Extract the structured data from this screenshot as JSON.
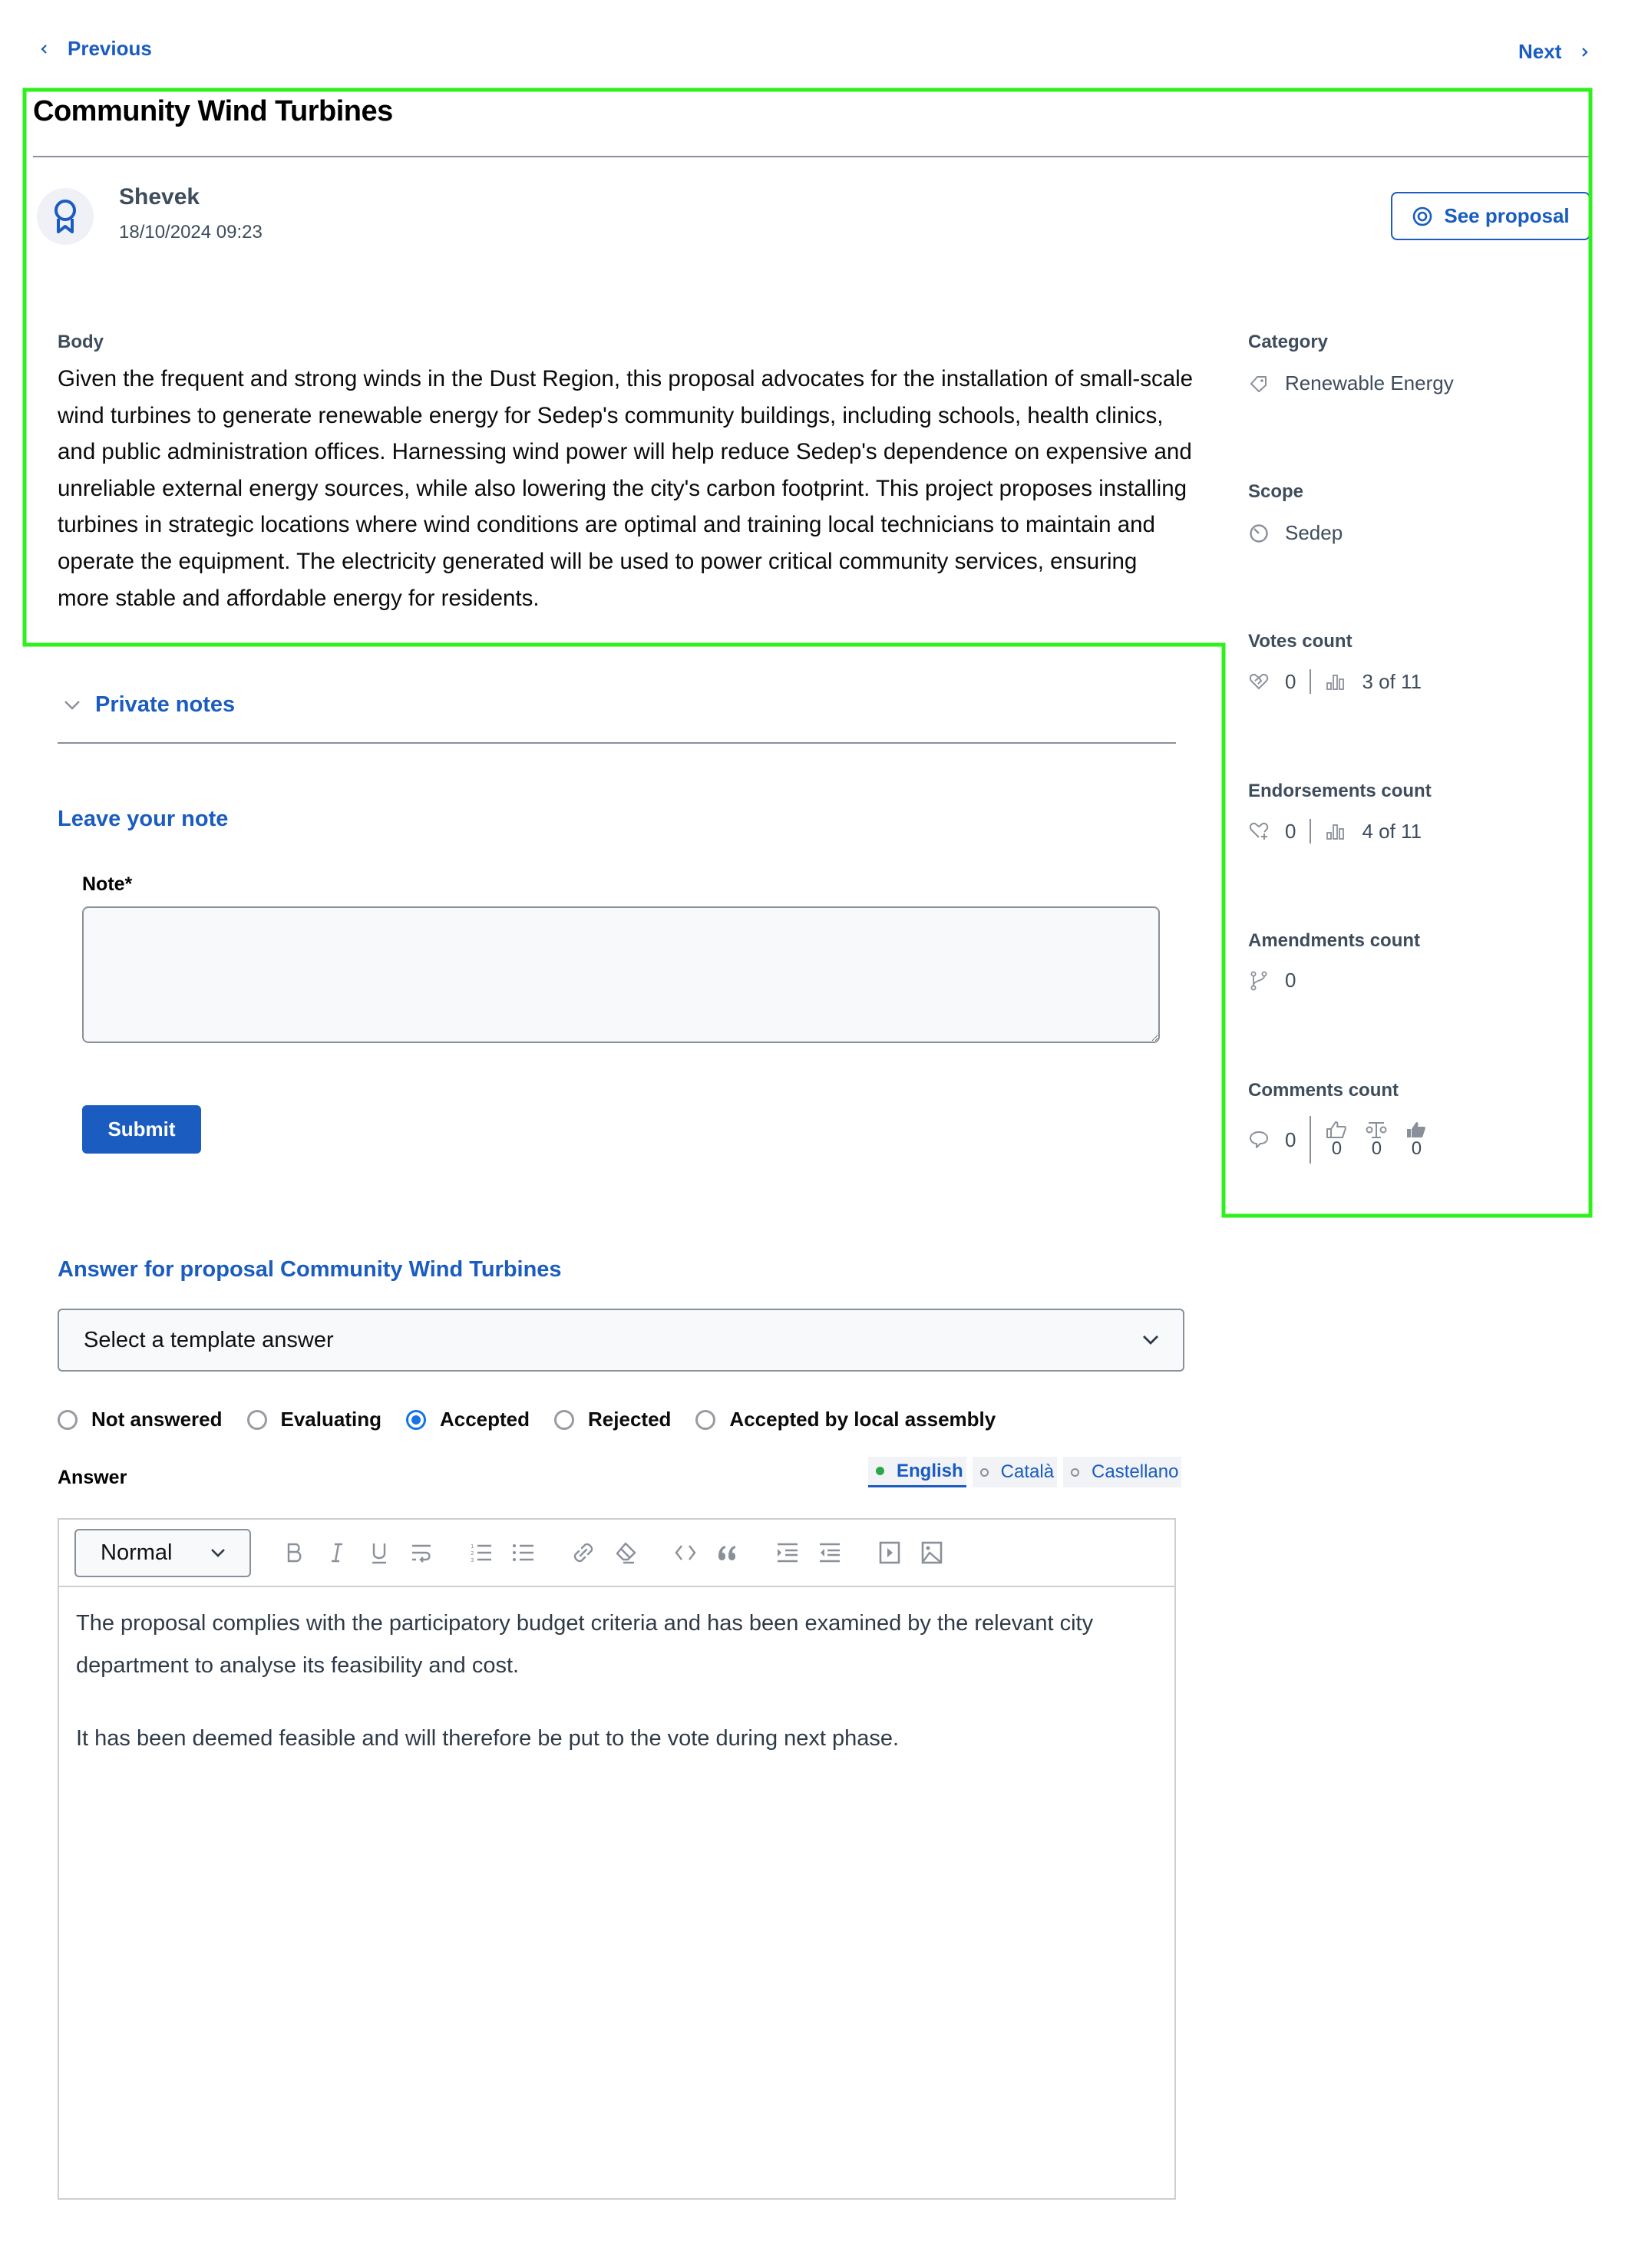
{
  "nav": {
    "previous_label": "Previous",
    "next_label": "Next"
  },
  "proposal": {
    "title": "Community Wind Turbines",
    "author": {
      "name": "Shevek",
      "date": "18/10/2024 09:23",
      "avatar_icon": "award-ribbon-icon"
    },
    "see_proposal_label": "See proposal",
    "body_label": "Body",
    "body": "Given the frequent and strong winds in the Dust Region, this proposal advocates for the installation of small-scale wind turbines to generate renewable energy for Sedep's community buildings, including schools, health clinics, and public administration offices. Harnessing wind power will help reduce Sedep's dependence on expensive and unreliable external energy sources, while also lowering the city's carbon footprint. This project proposes installing turbines in strategic locations where wind conditions are optimal and training local technicians to maintain and operate the equipment. The electricity generated will be used to power critical community services, ensuring more stable and affordable energy for residents."
  },
  "sidebar": {
    "category": {
      "label": "Category",
      "value": "Renewable Energy",
      "icon": "tag-icon"
    },
    "scope": {
      "label": "Scope",
      "value": "Sedep",
      "icon": "scope-icon"
    },
    "votes": {
      "label": "Votes count",
      "count": "0",
      "ranking": "3 of 11"
    },
    "endorsements": {
      "label": "Endorsements count",
      "count": "0",
      "ranking": "4 of 11"
    },
    "amendments": {
      "label": "Amendments count",
      "count": "0"
    },
    "comments": {
      "label": "Comments count",
      "count": "0",
      "in_favor": "0",
      "neutral": "0",
      "against": "0"
    }
  },
  "private_notes": {
    "toggle_label": "Private notes",
    "form_title": "Leave your note",
    "note_label": "Note*",
    "note_value": "",
    "submit_label": "Submit"
  },
  "answer": {
    "heading": "Answer for proposal Community Wind Turbines",
    "template_select": {
      "selected": "Select a template answer"
    },
    "states": [
      {
        "label": "Not answered",
        "checked": false
      },
      {
        "label": "Evaluating",
        "checked": false
      },
      {
        "label": "Accepted",
        "checked": true
      },
      {
        "label": "Rejected",
        "checked": false
      },
      {
        "label": "Accepted by local assembly",
        "checked": false
      }
    ],
    "answer_label": "Answer",
    "languages": [
      {
        "label": "English",
        "active": true
      },
      {
        "label": "Català",
        "active": false
      },
      {
        "label": "Castellano",
        "active": false
      }
    ],
    "editor": {
      "format_select": "Normal",
      "toolbar": [
        "bold",
        "italic",
        "underline",
        "hard-break",
        "ordered-list",
        "bullet-list",
        "link",
        "clear-format",
        "code",
        "blockquote",
        "indent",
        "outdent",
        "video",
        "image"
      ],
      "paragraphs": [
        "The proposal complies with the participatory budget criteria and has been examined by the relevant city department to analyse its feasibility and cost.",
        "It has been deemed feasible and will therefore be put to the vote during next phase."
      ]
    }
  },
  "colors": {
    "primary": "#1a5cc0",
    "radio_checked": "#1673e6",
    "active_language_dot": "#2aa748",
    "highlight_annotation": "#2ef01d"
  }
}
